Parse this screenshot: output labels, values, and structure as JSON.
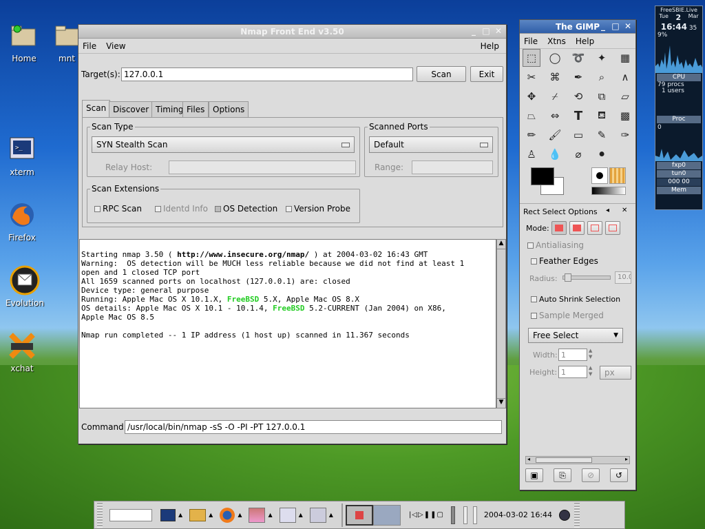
{
  "desktop_icons": [
    {
      "label": "Home"
    },
    {
      "label": "mnt"
    },
    {
      "label": "xterm"
    },
    {
      "label": "Firefox"
    },
    {
      "label": "Evolution"
    },
    {
      "label": "xchat"
    }
  ],
  "nmap": {
    "title": "Nmap Front End v3.50",
    "menu": {
      "file": "File",
      "view": "View",
      "help": "Help"
    },
    "targets_label": "Target(s):",
    "targets_value": "127.0.0.1",
    "scan_button": "Scan",
    "exit_button": "Exit",
    "tabs": [
      "Scan",
      "Discover",
      "Timing",
      "Files",
      "Options"
    ],
    "scan_type": {
      "title": "Scan Type",
      "selected": "SYN Stealth Scan",
      "relay_label": "Relay Host:"
    },
    "scanned_ports": {
      "title": "Scanned Ports",
      "selected": "Default",
      "range_label": "Range:"
    },
    "extensions": {
      "title": "Scan Extensions",
      "rpc": "RPC Scan",
      "identd": "Identd Info",
      "os": "OS Detection",
      "version": "Version Probe"
    },
    "output": {
      "l1a": "Starting nmap 3.50 ( ",
      "l1b": "http://www.insecure.org/nmap/",
      "l1c": " ) at 2004-03-02 16:43 GMT",
      "l2": "Warning:  OS detection will be MUCH less reliable because we did not find at least 1",
      "l3": "open and 1 closed TCP port",
      "l4": "All 1659 scanned ports on localhost (127.0.0.1) are: closed",
      "l5": "Device type: general purpose",
      "l6a": "Running: Apple Mac OS X 10.1.X, ",
      "l6b": "FreeBSD",
      "l6c": " 5.X, Apple Mac OS 8.X",
      "l7a": "OS details: Apple Mac OS X 10.1 - 10.1.4, ",
      "l7b": "FreeBSD",
      "l7c": " 5.2-CURRENT (Jan 2004) on X86,",
      "l8": "Apple Mac OS 8.5",
      "l9": "Nmap run completed -- 1 IP address (1 host up) scanned in 11.367 seconds"
    },
    "command_label": "Command:",
    "command_value": "/usr/local/bin/nmap -sS -O -PI -PT 127.0.0.1"
  },
  "gimp": {
    "title": "The GIMP",
    "menu": {
      "file": "File",
      "xtns": "Xtns",
      "help": "Help"
    },
    "options_title": "Rect Select Options",
    "mode_label": "Mode:",
    "antialiasing": "Antialiasing",
    "feather_edges": "Feather Edges",
    "radius_label": "Radius:",
    "radius_value": "10.0",
    "auto_shrink": "Auto Shrink Selection",
    "sample_merged": "Sample Merged",
    "free_select": "Free Select",
    "width_label": "Width:",
    "width_value": "1",
    "height_label": "Height:",
    "height_value": "1",
    "unit": "px"
  },
  "monitor": {
    "title": "FreeSBIE.Live",
    "day": "Tue",
    "date": "2",
    "month": "Mar",
    "time": "16:44",
    "seconds": "35",
    "percent": "9%",
    "cpu": "CPU",
    "procs": "79 procs",
    "users": "1 users",
    "proc": "Proc",
    "proc_value": "0",
    "fxp0": "fxp0",
    "tun0": "tun0",
    "net_value": "000 00",
    "mem": "Mem"
  },
  "panel": {
    "clock": "2004-03-02 16:44"
  },
  "colors": {
    "freebsd_green": "#22cc22",
    "titlebar_active": "#2f5ea8"
  }
}
